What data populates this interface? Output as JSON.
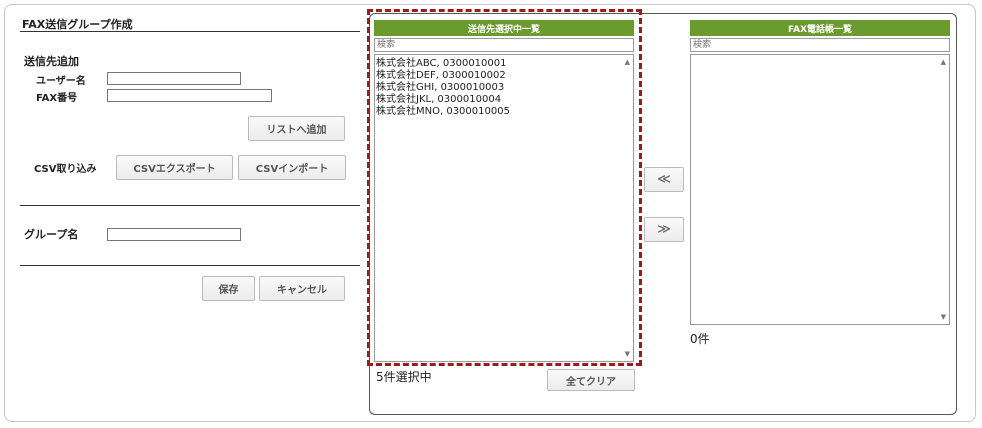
{
  "left": {
    "title": "FAX送信グループ作成",
    "add_section": "送信先追加",
    "user_label": "ユーザー名",
    "fax_label": "FAX番号",
    "user_value": "",
    "fax_value": "",
    "add_button": "リストへ追加",
    "csv_label": "CSV取り込み",
    "export_button": "CSVエクスポート",
    "import_button": "CSVインポート",
    "group_label": "グループ名",
    "group_value": "",
    "save_button": "保存",
    "cancel_button": "キャンセル"
  },
  "selected": {
    "header": "送信先選択中一覧",
    "search_placeholder": "検索",
    "items": [
      "株式会社ABC, 0300010001",
      "株式会社DEF, 0300010002",
      "株式会社GHI, 0300010003",
      "株式会社JKL, 0300010004",
      "株式会社MNO, 0300010005"
    ],
    "count": "5件選択中",
    "clear_button": "全てクリア"
  },
  "move": {
    "left_button": "≪",
    "right_button": "≫"
  },
  "phonebook": {
    "header": "FAX電話帳一覧",
    "search_placeholder": "検索",
    "count": "0件"
  },
  "icons": {
    "scroll_up": "▲",
    "scroll_down": "▼"
  }
}
